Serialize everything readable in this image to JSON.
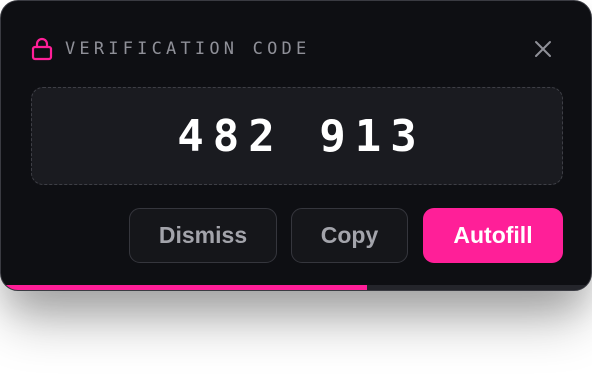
{
  "header": {
    "icon": "lock-icon",
    "title": "VERIFICATION CODE",
    "close_icon": "close-icon"
  },
  "code": {
    "value": "482 913"
  },
  "actions": {
    "dismiss_label": "Dismiss",
    "copy_label": "Copy",
    "autofill_label": "Autofill"
  },
  "expiry": {
    "remaining_fraction": 0.62
  },
  "colors": {
    "accent": "#ff1f98",
    "background": "#0e0f13",
    "code_box": "#1a1b20",
    "muted_text": "#8f9098"
  }
}
